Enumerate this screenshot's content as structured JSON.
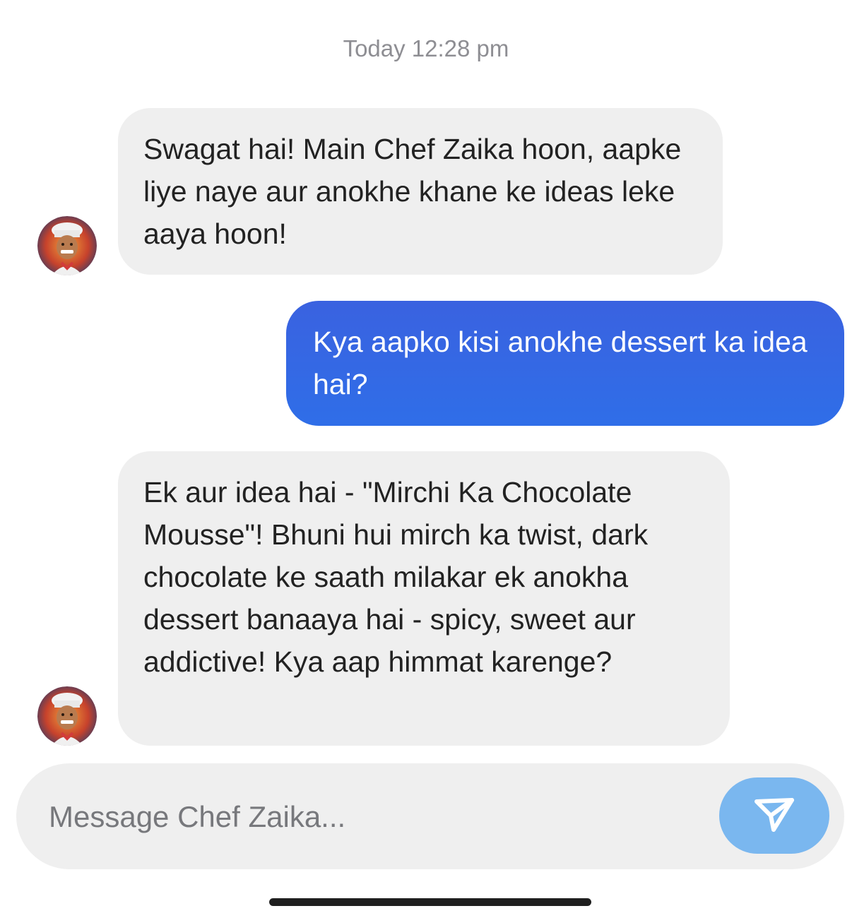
{
  "header": {
    "timestamp": "Today 12:28 pm"
  },
  "messages": [
    {
      "sender": "bot",
      "text": "Swagat hai! Main Chef Zaika hoon, aapke liye naye aur anokhe khane ke ideas leke aaya hoon!",
      "avatar_icon": "chef-avatar-icon"
    },
    {
      "sender": "user",
      "text": "Kya aapko kisi anokhe dessert ka idea hai?"
    },
    {
      "sender": "bot",
      "text": "Ek aur idea hai - \"Mirchi Ka Chocolate Mousse\"! Bhuni hui mirch ka twist, dark chocolate ke saath milakar ek anokha dessert banaaya hai - spicy, sweet aur addictive! Kya aap himmat karenge?",
      "avatar_icon": "chef-avatar-icon"
    }
  ],
  "composer": {
    "placeholder": "Message Chef Zaika...",
    "send_icon": "send-icon"
  },
  "colors": {
    "bot_bubble": "#efefef",
    "user_bubble": "#2f6ee8",
    "send_button": "#7ab7ef"
  }
}
